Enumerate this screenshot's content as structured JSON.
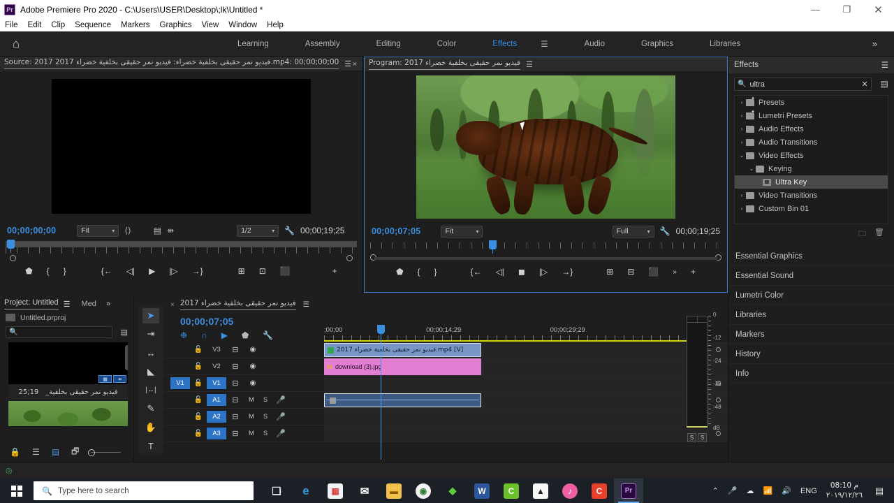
{
  "window": {
    "title": "Adobe Premiere Pro 2020 - C:\\Users\\USER\\Desktop\\;lk\\Untitled *",
    "logo": "Pr",
    "minimize": "—",
    "maximize": "❐",
    "close": "✕"
  },
  "menu": [
    "File",
    "Edit",
    "Clip",
    "Sequence",
    "Markers",
    "Graphics",
    "View",
    "Window",
    "Help"
  ],
  "workspace": {
    "home_icon": "⌂",
    "tabs": [
      "Learning",
      "Assembly",
      "Editing",
      "Color",
      "Effects",
      "Audio",
      "Graphics",
      "Libraries"
    ],
    "active_tab": "Effects",
    "burger": "☰",
    "more": "»"
  },
  "source_monitor": {
    "tab_label": "Source: 2017 فيديو نمر حقيقى بخلفية خضراء: فيديو نمر حقيقى بخلفية خضراء 2017.mp4: 00;00;00;00",
    "burger": "☰",
    "more": "»",
    "current_time": "00;00;00;00",
    "zoom_level": "Fit",
    "resolution": "1/2",
    "duration": "00;00;19;25",
    "settings_icon": "wrench-icon",
    "buttons": [
      "marker",
      "mark-in",
      "mark-out",
      "go-to-in",
      "step-back",
      "play",
      "step-forward",
      "go-to-out",
      "lift",
      "extract",
      "export-frame"
    ],
    "add_button": "+"
  },
  "program_monitor": {
    "tab_label": "Program: 2017 فيديو نمر حقيقى بخلفية خضراء",
    "burger": "☰",
    "current_time": "00;00;07;05",
    "zoom_level": "Fit",
    "quality": "Full",
    "duration": "00;00;19;25",
    "buttons": [
      "marker",
      "mark-in",
      "mark-out",
      "go-to-in",
      "step-back",
      "stop",
      "step-forward",
      "go-to-out",
      "lift",
      "extract",
      "export-frame"
    ],
    "more": "»",
    "add_button": "+"
  },
  "effects_panel": {
    "title": "Effects",
    "burger": "☰",
    "search_value": "ultra",
    "clear_icon": "✕",
    "tree": [
      {
        "label": "Presets",
        "indent": 0,
        "arrow": "›",
        "type": "folder-star",
        "selected": false
      },
      {
        "label": "Lumetri Presets",
        "indent": 0,
        "arrow": "›",
        "type": "folder-star",
        "selected": false
      },
      {
        "label": "Audio Effects",
        "indent": 0,
        "arrow": "›",
        "type": "folder",
        "selected": false
      },
      {
        "label": "Audio Transitions",
        "indent": 0,
        "arrow": "›",
        "type": "folder",
        "selected": false
      },
      {
        "label": "Video Effects",
        "indent": 0,
        "arrow": "⌄",
        "type": "folder",
        "selected": false
      },
      {
        "label": "Keying",
        "indent": 1,
        "arrow": "⌄",
        "type": "folder",
        "selected": false
      },
      {
        "label": "Ultra Key",
        "indent": 2,
        "arrow": "",
        "type": "effect",
        "selected": true
      },
      {
        "label": "Video Transitions",
        "indent": 0,
        "arrow": "›",
        "type": "folder",
        "selected": false
      },
      {
        "label": "Custom Bin 01",
        "indent": 0,
        "arrow": "›",
        "type": "folder",
        "selected": false
      }
    ],
    "footer_icons": [
      "new-bin-icon",
      "delete-icon"
    ]
  },
  "rail_panels": [
    "Essential Graphics",
    "Essential Sound",
    "Lumetri Color",
    "Libraries",
    "Markers",
    "History",
    "Info"
  ],
  "project_panel": {
    "title": "Project: Untitled",
    "burger": "☰",
    "second_tab": "Med",
    "more": "»",
    "file_name": "Untitled.prproj",
    "search_placeholder": "",
    "items": [
      {
        "name": "فيديو نمر حقيقى بخلفية_",
        "duration": "19;25",
        "badges": [
          "film-icon",
          "audio-icon"
        ]
      },
      {
        "name": "download (3).jpg",
        "duration": "",
        "badges": []
      }
    ],
    "footer_icons": [
      "lock-icon",
      "list-view-icon",
      "icon-view-icon",
      "freeform-view-icon",
      "zoom-slider"
    ]
  },
  "tools": [
    {
      "name": "selection-tool",
      "glyph": "➤",
      "active": true
    },
    {
      "name": "track-select-forward-tool",
      "glyph": "⇥",
      "active": false
    },
    {
      "name": "ripple-edit-tool",
      "glyph": "↔",
      "active": false
    },
    {
      "name": "razor-tool",
      "glyph": "◢",
      "active": false
    },
    {
      "name": "slip-tool",
      "glyph": "|↔|",
      "active": false
    },
    {
      "name": "pen-tool",
      "glyph": "✎",
      "active": false
    },
    {
      "name": "hand-tool",
      "glyph": "✋",
      "active": false
    },
    {
      "name": "type-tool",
      "glyph": "T",
      "active": false
    }
  ],
  "timeline": {
    "tab_label": "2017 فيديو نمر حقيقى بخلفية خضراء",
    "close_icon": "×",
    "burger": "☰",
    "current_time": "00;00;07;05",
    "tool_icons": [
      "nest-icon",
      "snap-icon",
      "linked-selection-icon",
      "marker-icon",
      "settings-icon"
    ],
    "ruler_labels": [
      {
        "text": ";00;00",
        "left_pct": 0
      },
      {
        "text": "00;00;14;29",
        "left_pct": 28
      },
      {
        "text": "00;00;29;29",
        "left_pct": 62
      }
    ],
    "tracks": [
      {
        "id": "V3",
        "type": "video",
        "source_target": "",
        "targeted": false,
        "clip": null
      },
      {
        "id": "V2",
        "type": "video",
        "source_target": "",
        "targeted": false,
        "clip": {
          "label": "2017 فيديو نمر حقيقى بخلفية خضراء.mp4 [V]",
          "style": "video"
        }
      },
      {
        "id": "V2b",
        "type": "video-overlay",
        "source_target": "",
        "targeted": false,
        "clip": {
          "label": "download (3).jpg",
          "style": "pink"
        }
      },
      {
        "id": "V1",
        "type": "video",
        "source_target": "V1",
        "targeted": true,
        "clip": null
      },
      {
        "id": "A1",
        "type": "audio",
        "source_target": "",
        "targeted": true,
        "mute": "M",
        "solo": "S",
        "clip": {
          "label": "",
          "style": "audio"
        }
      },
      {
        "id": "A2",
        "type": "audio",
        "source_target": "",
        "targeted": true,
        "mute": "M",
        "solo": "S",
        "clip": null
      },
      {
        "id": "A3",
        "type": "audio",
        "source_target": "",
        "targeted": true,
        "mute": "M",
        "solo": "S",
        "clip": null
      }
    ]
  },
  "audio_meter": {
    "scale": [
      "0",
      "-12",
      "-24",
      "-36",
      "-48",
      "dB"
    ],
    "solo_buttons": [
      "S",
      "S"
    ]
  },
  "taskbar": {
    "search_placeholder": "Type here to search",
    "search_icon": "search-icon",
    "apps": [
      {
        "name": "task-view-icon",
        "glyph": "❏",
        "color": "#1b1f26",
        "text": "#dfe4ea",
        "active": false
      },
      {
        "name": "edge-icon",
        "glyph": "e",
        "color": "#1b1f26",
        "text": "#2f9ae0",
        "active": false
      },
      {
        "name": "microsoft-store-icon",
        "glyph": "▦",
        "color": "#f3f3f3",
        "text": "#d44",
        "active": false
      },
      {
        "name": "mail-icon",
        "glyph": "✉",
        "color": "#1b1f26",
        "text": "#ffffff",
        "active": false
      },
      {
        "name": "file-explorer-icon",
        "glyph": "▬",
        "color": "#f3c04a",
        "text": "#8a5b00",
        "active": false
      },
      {
        "name": "chrome-icon",
        "glyph": "◉",
        "color": "#f3f3f3",
        "text": "#2e7d32",
        "active": false
      },
      {
        "name": "idm-icon",
        "glyph": "◆",
        "color": "#1b1f26",
        "text": "#5fcf3f",
        "active": false
      },
      {
        "name": "word-icon",
        "glyph": "W",
        "color": "#2b579a",
        "text": "#ffffff",
        "active": false
      },
      {
        "name": "camtasia-icon",
        "glyph": "C",
        "color": "#6abf2a",
        "text": "#ffffff",
        "active": false
      },
      {
        "name": "photos-icon",
        "glyph": "▲",
        "color": "#f7f7f7",
        "text": "#222222",
        "active": false
      },
      {
        "name": "itunes-icon",
        "glyph": "♪",
        "color": "#ef5fa0",
        "text": "#ffffff",
        "active": false
      },
      {
        "name": "camtasia-studio-icon",
        "glyph": "C",
        "color": "#e8402a",
        "text": "#ffffff",
        "active": false
      },
      {
        "name": "premiere-pro-icon",
        "glyph": "Pr",
        "color": "#2a0a3e",
        "text": "#cf96f0",
        "active": true
      }
    ],
    "tray": {
      "chevron": "⌃",
      "mic_icon": "🎤",
      "onedrive_icon": "☁",
      "network_icon": "📶",
      "volume_icon": "🔊",
      "language": "ENG",
      "time": "08:10 م",
      "date": "٢٠١٩/١٢/٢٦",
      "notification_icon": "▤"
    }
  }
}
